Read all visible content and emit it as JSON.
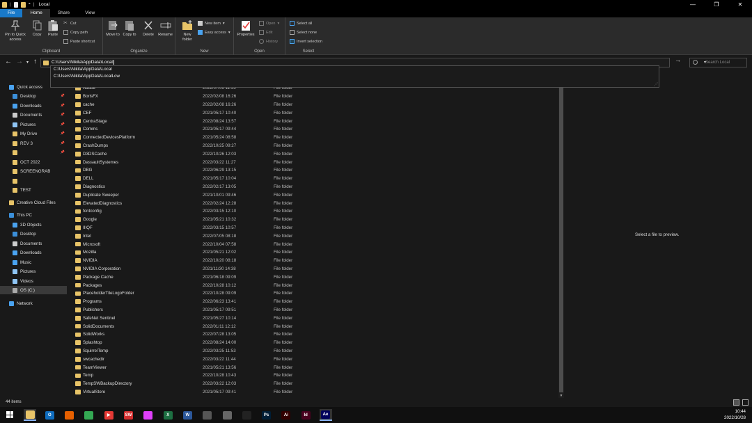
{
  "window": {
    "title": "Local",
    "controls": [
      "—",
      "❐",
      "✕"
    ]
  },
  "tabs": [
    "File",
    "Home",
    "Share",
    "View"
  ],
  "ribbon": {
    "clipboard": {
      "label": "Clipboard",
      "pin": "Pin to Quick access",
      "copy": "Copy",
      "paste": "Paste",
      "cut": "Cut",
      "copy_path": "Copy path",
      "paste_shortcut": "Paste shortcut"
    },
    "organize": {
      "label": "Organize",
      "move_to": "Move to",
      "copy_to": "Copy to",
      "delete": "Delete",
      "rename": "Rename"
    },
    "new": {
      "label": "New",
      "new_folder": "New folder",
      "new_item": "New item",
      "easy_access": "Easy access"
    },
    "open": {
      "label": "Open",
      "properties": "Properties",
      "open": "Open",
      "edit": "Edit",
      "history": "History"
    },
    "select": {
      "label": "Select",
      "select_all": "Select all",
      "select_none": "Select none",
      "invert_selection": "Invert selection"
    }
  },
  "address": {
    "value": "C:\\Users\\Nikita\\AppData\\Local",
    "search_placeholder": "Search Local",
    "suggestions": [
      "C:\\Users\\Nikita\\AppData\\Local",
      "C:\\Users\\Nikita\\AppData\\LocalLow"
    ]
  },
  "sidebar": {
    "items": [
      {
        "label": "Quick access",
        "icon": "star-icon",
        "color": "#4aa3f0",
        "pinned": false,
        "indent": 0
      },
      {
        "label": "Desktop",
        "icon": "desktop-icon",
        "color": "#3b8fd9",
        "pinned": true,
        "indent": 1
      },
      {
        "label": "Downloads",
        "icon": "download-icon",
        "color": "#4aa3f0",
        "pinned": true,
        "indent": 1
      },
      {
        "label": "Documents",
        "icon": "document-icon",
        "color": "#ccc",
        "pinned": true,
        "indent": 1
      },
      {
        "label": "Pictures",
        "icon": "pictures-icon",
        "color": "#8fc5f5",
        "pinned": true,
        "indent": 1
      },
      {
        "label": "My Drive",
        "icon": "folder-icon",
        "color": "#e8c468",
        "pinned": true,
        "indent": 1
      },
      {
        "label": "REV 3",
        "icon": "folder-icon",
        "color": "#e8c468",
        "pinned": true,
        "indent": 1
      },
      {
        "label": "",
        "icon": "folder-icon",
        "color": "#e8c468",
        "pinned": true,
        "indent": 1
      },
      {
        "label": "OCT 2022",
        "icon": "folder-icon",
        "color": "#e8c468",
        "pinned": false,
        "indent": 1
      },
      {
        "label": "SCREENGRAB",
        "icon": "folder-icon",
        "color": "#e8c468",
        "pinned": false,
        "indent": 1
      },
      {
        "label": "",
        "icon": "folder-icon",
        "color": "#e8c468",
        "pinned": false,
        "indent": 1
      },
      {
        "label": "TEST",
        "icon": "folder-icon",
        "color": "#e8c468",
        "pinned": false,
        "indent": 1
      },
      {
        "label": "Creative Cloud Files",
        "icon": "creative-cloud-icon",
        "color": "#e8c468",
        "pinned": false,
        "indent": 0
      },
      {
        "label": "This PC",
        "icon": "computer-icon",
        "color": "#3b8fd9",
        "pinned": false,
        "indent": 0
      },
      {
        "label": "3D Objects",
        "icon": "3d-objects-icon",
        "color": "#4aa3f0",
        "pinned": false,
        "indent": 1
      },
      {
        "label": "Desktop",
        "icon": "desktop-icon",
        "color": "#3b8fd9",
        "pinned": false,
        "indent": 1
      },
      {
        "label": "Documents",
        "icon": "document-icon",
        "color": "#ccc",
        "pinned": false,
        "indent": 1
      },
      {
        "label": "Downloads",
        "icon": "download-icon",
        "color": "#4aa3f0",
        "pinned": false,
        "indent": 1
      },
      {
        "label": "Music",
        "icon": "music-icon",
        "color": "#4aa3f0",
        "pinned": false,
        "indent": 1
      },
      {
        "label": "Pictures",
        "icon": "pictures-icon",
        "color": "#8fc5f5",
        "pinned": false,
        "indent": 1
      },
      {
        "label": "Videos",
        "icon": "video-icon",
        "color": "#8fc5f5",
        "pinned": false,
        "indent": 1
      },
      {
        "label": "OS (C:)",
        "icon": "drive-icon",
        "color": "#aaa",
        "pinned": false,
        "indent": 1,
        "selected": true
      },
      {
        "label": "Network",
        "icon": "network-icon",
        "color": "#4aa3f0",
        "pinned": false,
        "indent": 0
      }
    ]
  },
  "files": [
    {
      "name": "Adobe",
      "date": "2022/07/06 11:55",
      "type": "File folder"
    },
    {
      "name": "BorisFX",
      "date": "2022/02/08 16:26",
      "type": "File folder"
    },
    {
      "name": "cache",
      "date": "2022/02/08 16:26",
      "type": "File folder"
    },
    {
      "name": "CEF",
      "date": "2021/05/17 10:40",
      "type": "File folder"
    },
    {
      "name": "CentraStage",
      "date": "2022/08/24 13:57",
      "type": "File folder"
    },
    {
      "name": "Comms",
      "date": "2021/05/17 09:44",
      "type": "File folder"
    },
    {
      "name": "ConnectedDevicesPlatform",
      "date": "2021/05/24 08:58",
      "type": "File folder"
    },
    {
      "name": "CrashDumps",
      "date": "2022/10/25 09:27",
      "type": "File folder"
    },
    {
      "name": "D3DSCache",
      "date": "2022/10/26 12:03",
      "type": "File folder"
    },
    {
      "name": "DassaultSystemes",
      "date": "2022/03/22 11:27",
      "type": "File folder"
    },
    {
      "name": "DBG",
      "date": "2022/06/29 13:15",
      "type": "File folder"
    },
    {
      "name": "DELL",
      "date": "2021/05/17 10:04",
      "type": "File folder"
    },
    {
      "name": "Diagnostics",
      "date": "2022/02/17 13:05",
      "type": "File folder"
    },
    {
      "name": "Duplicate Sweeper",
      "date": "2021/10/01 09:46",
      "type": "File folder"
    },
    {
      "name": "ElevatedDiagnostics",
      "date": "2022/02/24 12:28",
      "type": "File folder"
    },
    {
      "name": "fontconfig",
      "date": "2022/03/15 12:10",
      "type": "File folder"
    },
    {
      "name": "Google",
      "date": "2021/05/21 10:32",
      "type": "File folder"
    },
    {
      "name": "IIIQF",
      "date": "2022/03/15 10:57",
      "type": "File folder"
    },
    {
      "name": "Intel",
      "date": "2022/07/05 08:18",
      "type": "File folder"
    },
    {
      "name": "Microsoft",
      "date": "2022/10/04 07:58",
      "type": "File folder"
    },
    {
      "name": "Mozilla",
      "date": "2021/05/21 12:02",
      "type": "File folder"
    },
    {
      "name": "NVIDIA",
      "date": "2022/10/20 08:18",
      "type": "File folder"
    },
    {
      "name": "NVIDIA Corporation",
      "date": "2021/11/30 14:38",
      "type": "File folder"
    },
    {
      "name": "Package Cache",
      "date": "2021/06/18 09:09",
      "type": "File folder"
    },
    {
      "name": "Packages",
      "date": "2022/10/28 10:12",
      "type": "File folder"
    },
    {
      "name": "PlaceholderTileLogoFolder",
      "date": "2022/10/28 09:09",
      "type": "File folder"
    },
    {
      "name": "Programs",
      "date": "2022/06/23 13:41",
      "type": "File folder"
    },
    {
      "name": "Publishers",
      "date": "2021/05/17 09:51",
      "type": "File folder"
    },
    {
      "name": "SafeNet Sentinel",
      "date": "2021/05/27 10:14",
      "type": "File folder"
    },
    {
      "name": "SolidDocuments",
      "date": "2022/01/11 12:12",
      "type": "File folder"
    },
    {
      "name": "SolidWorks",
      "date": "2022/07/28 13:05",
      "type": "File folder"
    },
    {
      "name": "Splashtop",
      "date": "2022/08/24 14:00",
      "type": "File folder"
    },
    {
      "name": "SquirrelTemp",
      "date": "2022/03/25 11:53",
      "type": "File folder"
    },
    {
      "name": "swcachedir",
      "date": "2022/03/22 11:44",
      "type": "File folder"
    },
    {
      "name": "TeamViewer",
      "date": "2021/05/21 13:56",
      "type": "File folder"
    },
    {
      "name": "Temp",
      "date": "2022/10/28 10:43",
      "type": "File folder"
    },
    {
      "name": "TempSWBackupDirectory",
      "date": "2022/03/22 12:03",
      "type": "File folder"
    },
    {
      "name": "VirtualStore",
      "date": "2021/05/17 09:41",
      "type": "File folder"
    }
  ],
  "preview": {
    "empty_text": "Select a file to preview."
  },
  "status": {
    "item_count": "44 items"
  },
  "taskbar": {
    "apps": [
      {
        "name": "file-explorer-icon",
        "label": "",
        "bg": "#e8c468",
        "active": true
      },
      {
        "name": "outlook-icon",
        "label": "O",
        "bg": "#0f6cbd"
      },
      {
        "name": "firefox-icon",
        "label": "",
        "bg": "#e66000"
      },
      {
        "name": "chrome-icon",
        "label": "",
        "bg": "#34a853"
      },
      {
        "name": "media-player-icon",
        "label": "▶",
        "bg": "#e53935"
      },
      {
        "name": "solidworks-icon",
        "label": "SW",
        "bg": "#d32f2f"
      },
      {
        "name": "photos-icon",
        "label": "",
        "bg": "#e040fb"
      },
      {
        "name": "excel-icon",
        "label": "X",
        "bg": "#1d6f42"
      },
      {
        "name": "word-icon",
        "label": "W",
        "bg": "#2b579a"
      },
      {
        "name": "calculator-icon",
        "label": "",
        "bg": "#555"
      },
      {
        "name": "cloud-app-icon",
        "label": "",
        "bg": "#666"
      },
      {
        "name": "sketchup-icon",
        "label": "",
        "bg": "#222"
      },
      {
        "name": "photoshop-icon",
        "label": "Ps",
        "bg": "#001e36"
      },
      {
        "name": "illustrator-icon",
        "label": "Ai",
        "bg": "#330000"
      },
      {
        "name": "indesign-icon",
        "label": "Id",
        "bg": "#49021f"
      },
      {
        "name": "after-effects-icon",
        "label": "Ae",
        "bg": "#00005b",
        "active": true
      }
    ],
    "time": "10:44",
    "date": "2022/10/28"
  },
  "colors": {
    "accent": "#1979c9",
    "folder": "#e8c468",
    "background": "#191919"
  }
}
